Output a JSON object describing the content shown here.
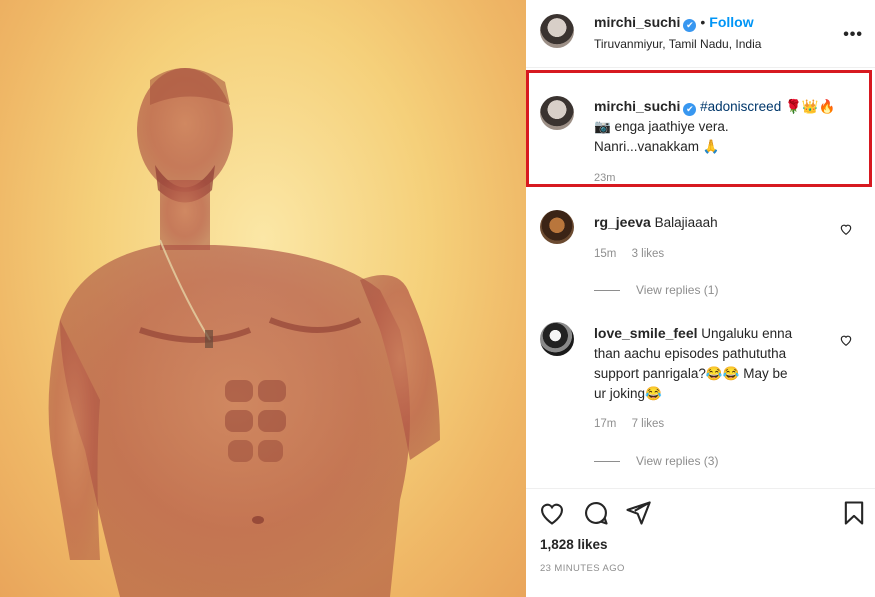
{
  "post": {
    "username": "mirchi_suchi",
    "verified_mark": "✔",
    "separator": "•",
    "follow_label": "Follow",
    "location": "Tiruvanmiyur, Tamil Nadu, India",
    "more_icon": "more-options-icon",
    "more_label": "•••",
    "caption": {
      "hashtag": "#adoniscreed",
      "hashtag_emoji": "🌹👑🔥",
      "line2": "📷 enga jaathiye vera.",
      "line3": "Nanri...vanakkam 🙏",
      "time": "23m"
    },
    "likes_count": "1,828 likes",
    "posted_ago": "23 MINUTES AGO",
    "highlight_color": "#d71920"
  },
  "comments": [
    {
      "username": "rg_jeeva",
      "text": "Balajiaaah",
      "time": "15m",
      "likes": "3 likes",
      "replies": "View replies (1)"
    },
    {
      "username": "love_smile_feel",
      "text_line1": "Ungaluku enna",
      "text_line2": "than aachu episodes pathututha",
      "text_line3": "support panrigala?😂😂 May be",
      "text_line4": "ur joking😂",
      "time": "17m",
      "likes": "7 likes",
      "replies": "View replies (3)"
    }
  ],
  "icons": {
    "like": "heart-icon",
    "comment": "comment-icon",
    "share": "send-icon",
    "save": "bookmark-icon"
  }
}
